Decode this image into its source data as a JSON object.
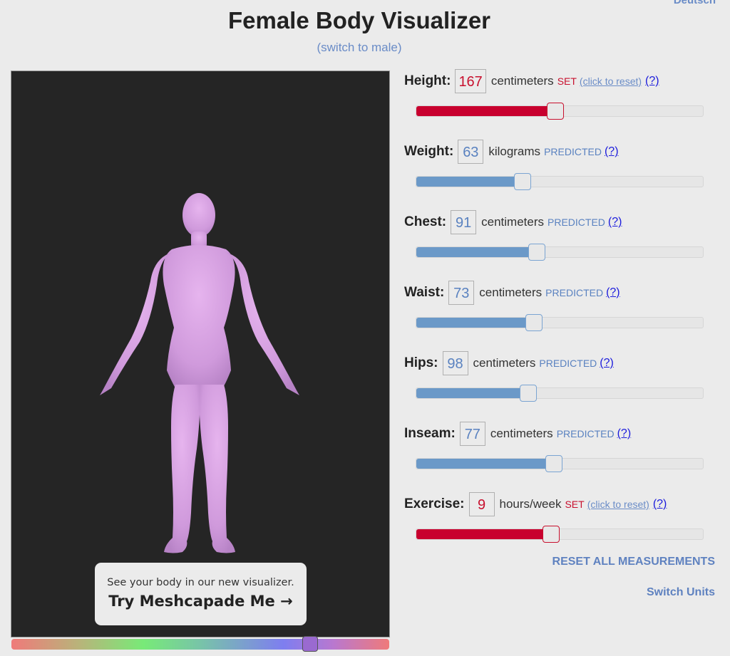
{
  "header": {
    "language_link": "Deutsch",
    "title": "Female Body Visualizer",
    "switch_gender": "(switch to male)"
  },
  "viewer": {
    "model_color": "#d9a3e3",
    "promo": {
      "subtitle": "See your body in our new visualizer.",
      "cta": "Try Meshcapade Me",
      "cta_icon": "arrow-right-icon",
      "arrow_glyph": "→"
    },
    "color_slider": {
      "value_fraction": 0.79,
      "thumb_color": "#9a6ad0"
    }
  },
  "measurements": [
    {
      "id": "height",
      "label": "Height:",
      "value": "167",
      "unit": "centimeters",
      "status": "SET",
      "is_set": true,
      "reset_label": "(click to reset)",
      "help": "(?)",
      "slider_fraction": 0.485
    },
    {
      "id": "weight",
      "label": "Weight:",
      "value": "63",
      "unit": "kilograms",
      "status": "PREDICTED",
      "is_set": false,
      "help": "(?)",
      "slider_fraction": 0.37
    },
    {
      "id": "chest",
      "label": "Chest:",
      "value": "91",
      "unit": "centimeters",
      "status": "PREDICTED",
      "is_set": false,
      "help": "(?)",
      "slider_fraction": 0.42
    },
    {
      "id": "waist",
      "label": "Waist:",
      "value": "73",
      "unit": "centimeters",
      "status": "PREDICTED",
      "is_set": false,
      "help": "(?)",
      "slider_fraction": 0.41
    },
    {
      "id": "hips",
      "label": "Hips:",
      "value": "98",
      "unit": "centimeters",
      "status": "PREDICTED",
      "is_set": false,
      "help": "(?)",
      "slider_fraction": 0.39
    },
    {
      "id": "inseam",
      "label": "Inseam:",
      "value": "77",
      "unit": "centimeters",
      "status": "PREDICTED",
      "is_set": false,
      "help": "(?)",
      "slider_fraction": 0.48
    },
    {
      "id": "exercise",
      "label": "Exercise:",
      "value": "9",
      "unit": "hours/week",
      "status": "SET",
      "is_set": true,
      "reset_label": "(click to reset)",
      "help": "(?)",
      "slider_fraction": 0.47
    }
  ],
  "actions": {
    "reset_all": "RESET ALL MEASUREMENTS",
    "switch_units": "Switch Units"
  },
  "colors": {
    "set": "#c8002e",
    "predicted": "#6b99c8",
    "link": "#6a8cc7",
    "viewer_bg": "#252525"
  }
}
